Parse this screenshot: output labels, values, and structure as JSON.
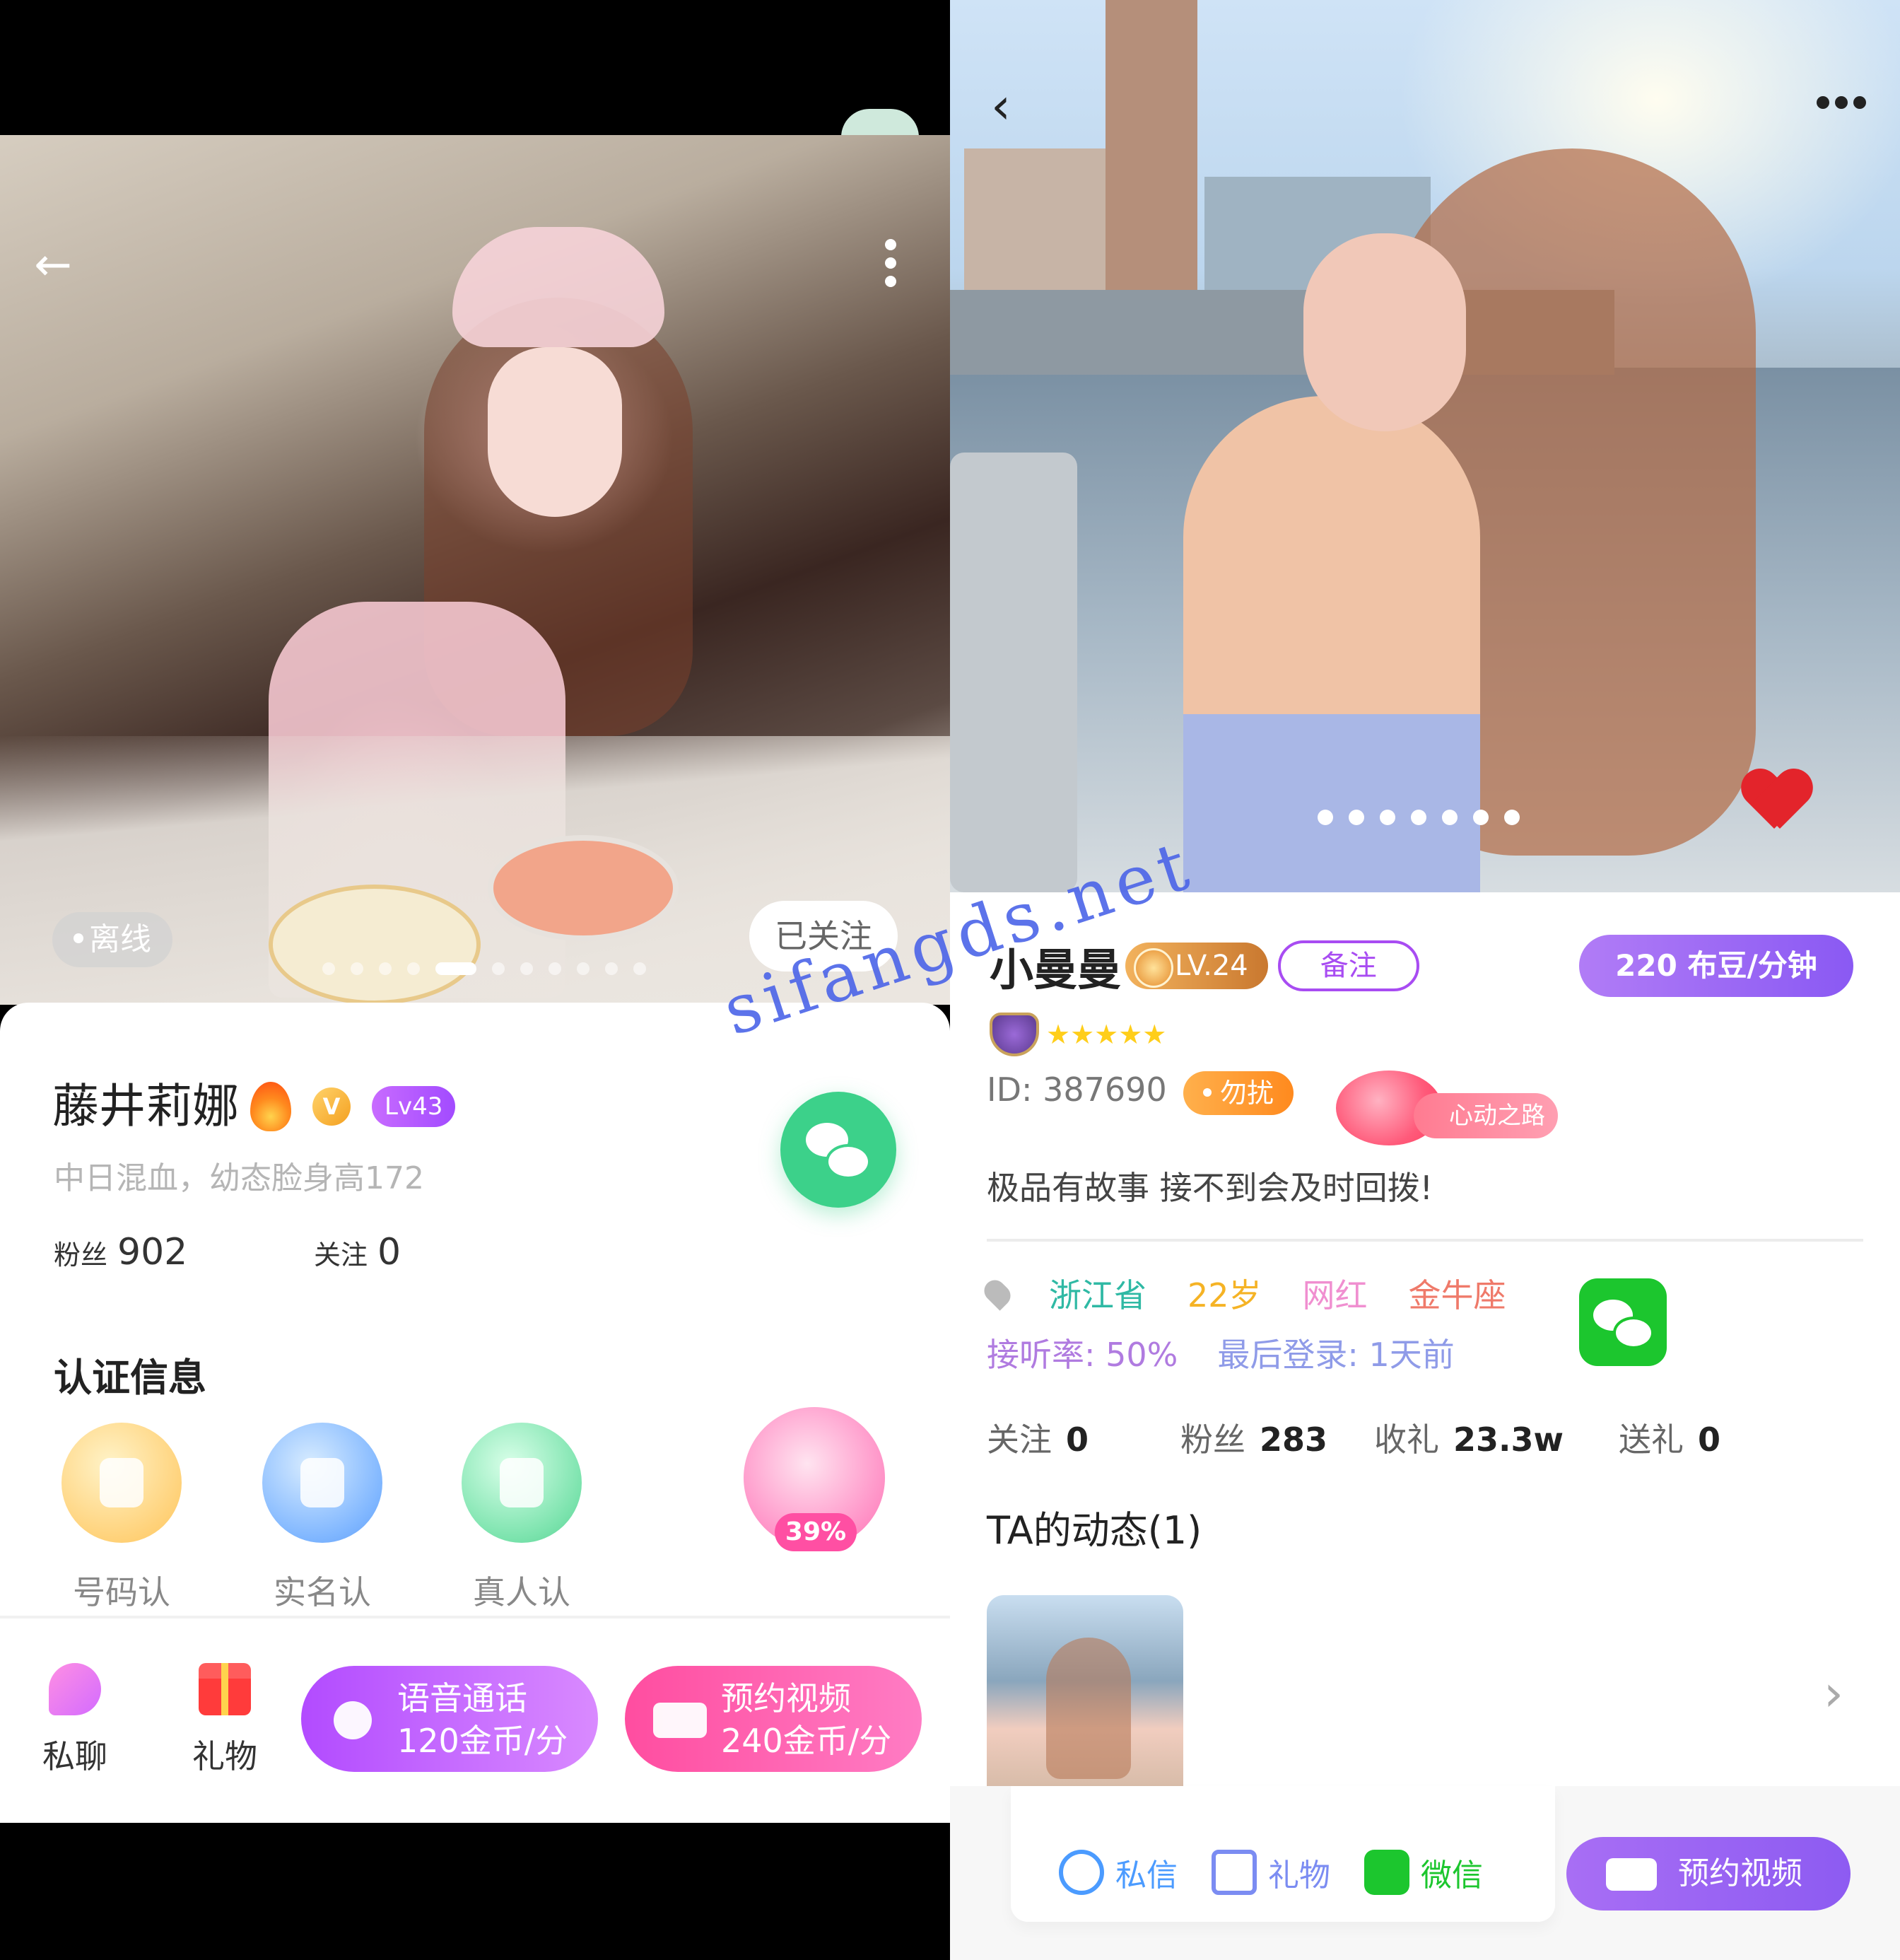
{
  "left": {
    "status": "离线",
    "follow_state": "已关注",
    "photo_index": 5,
    "photo_count": 11,
    "profile": {
      "name": "藤井莉娜",
      "level": "Lv43",
      "verified_badge": "V",
      "bio": "中日混血，幼态脸身高172",
      "fans_label": "粉丝",
      "fans": "902",
      "following_label": "关注",
      "following": "0"
    },
    "cert_title": "认证信息",
    "certs": [
      {
        "label": "号码认证",
        "icon": "phone-icon"
      },
      {
        "label": "实名认证",
        "icon": "id-card-icon"
      },
      {
        "label": "真人认证",
        "icon": "camera-icon"
      }
    ],
    "heart_percent": "39%",
    "bottom": {
      "chat_label": "私聊",
      "gift_label": "礼物",
      "voice_title": "语音通话",
      "voice_price": "120金币/分",
      "video_title": "预约视频",
      "video_price": "240金币/分"
    },
    "colors": {
      "wechat": "#3cd18a",
      "voice": "#b24bff",
      "video": "#ff4da0"
    }
  },
  "right": {
    "photo_count": 7,
    "profile": {
      "name": "小曼曼",
      "level": "LV.24",
      "note_button": "备注",
      "price": "220 布豆/分钟",
      "stars": "★★★★★",
      "id": "ID: 387690",
      "status": "勿扰",
      "heart_road": "心动之路",
      "bio": "极品有故事 接不到会及时回拨!"
    },
    "tags": {
      "province": "浙江省",
      "age": "22岁",
      "tag": "网红",
      "zodiac": "金牛座"
    },
    "info": {
      "answer_rate": "接听率: 50%",
      "last_login": "最后登录: 1天前"
    },
    "stats": [
      {
        "label": "关注",
        "value": "0"
      },
      {
        "label": "粉丝",
        "value": "283"
      },
      {
        "label": "收礼",
        "value": "23.3w"
      },
      {
        "label": "送礼",
        "value": "0"
      }
    ],
    "moments_title": "TA的动态(1)",
    "bottom": {
      "message": "私信",
      "gift": "礼物",
      "wechat": "微信",
      "reserve_video": "预约视频"
    },
    "colors": {
      "accent": "#8d5bf2",
      "province": "#2fb9a4",
      "age": "#f5b325",
      "tag": "#f08fd0",
      "zodiac": "#ef7a6a",
      "info": "#9b7be6"
    }
  },
  "watermark": "sifangds.net"
}
